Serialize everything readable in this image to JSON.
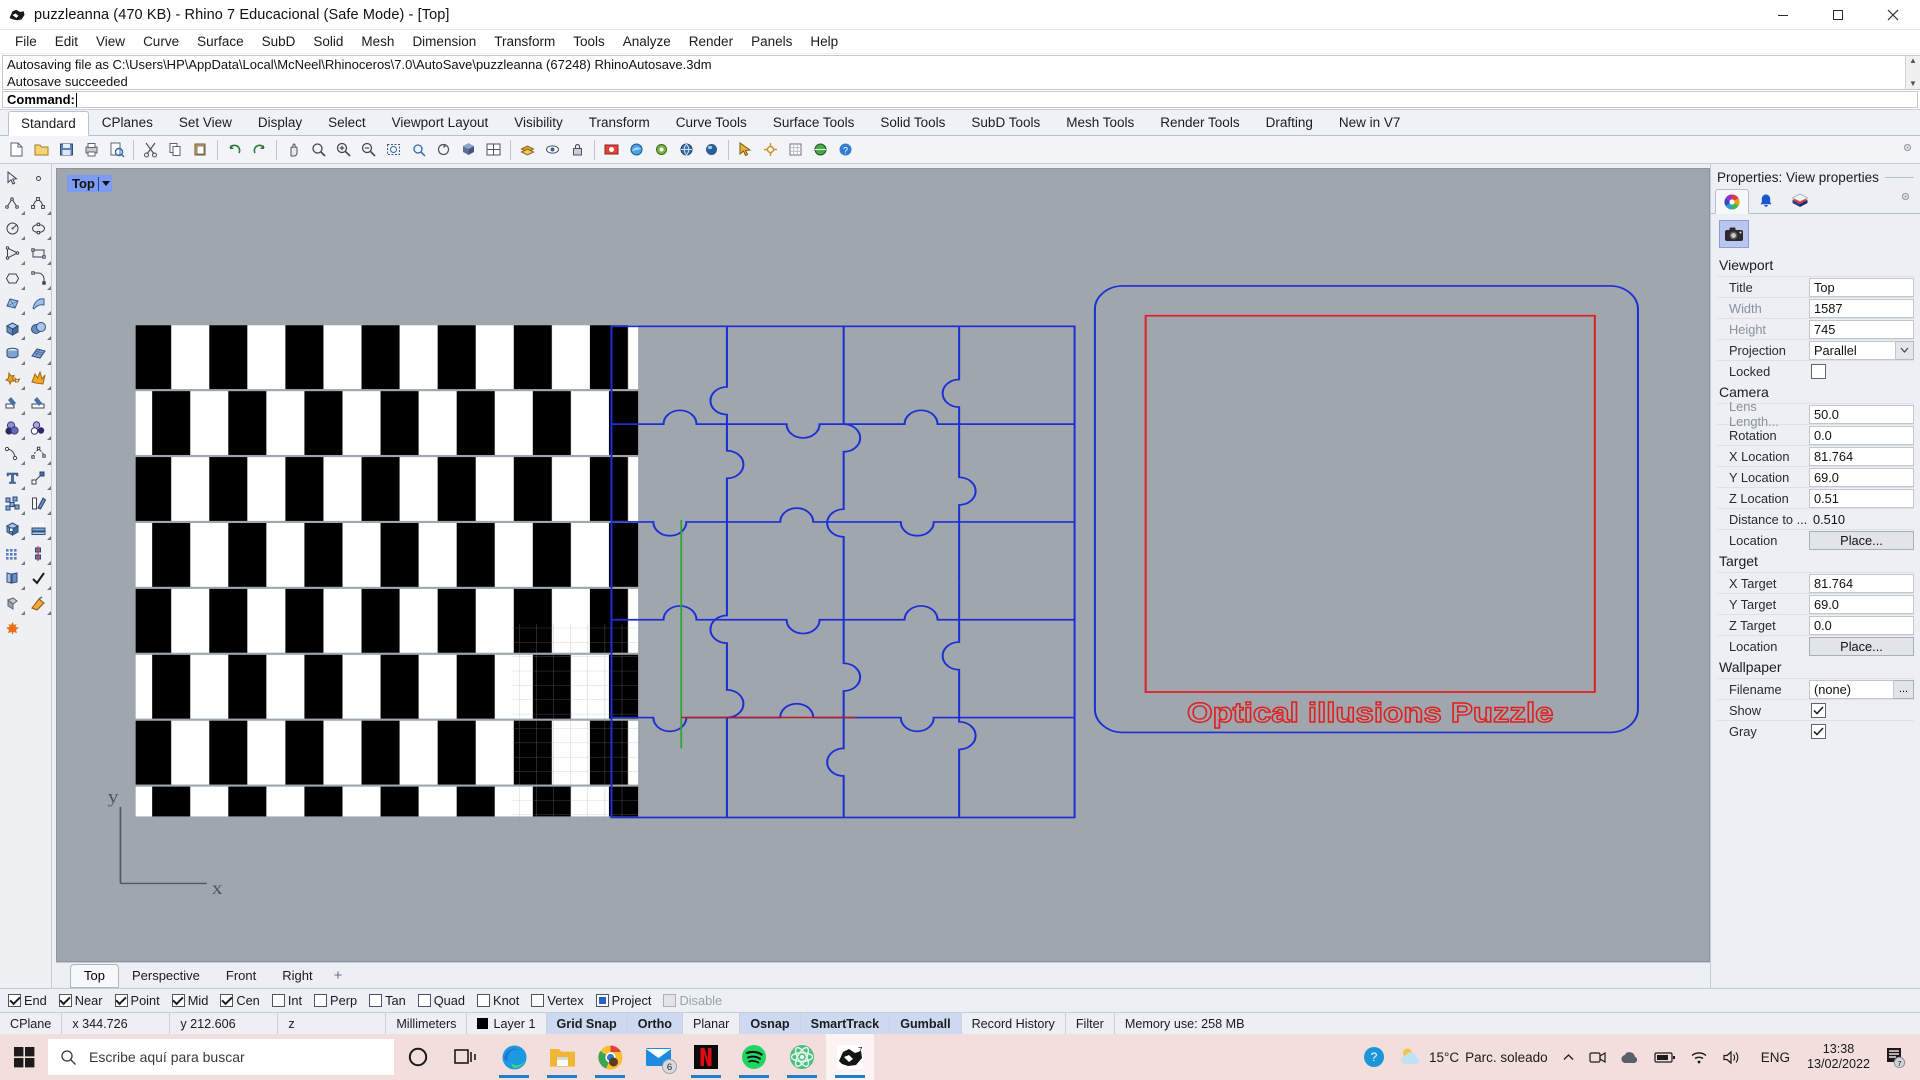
{
  "window": {
    "title": "puzzleanna (470 KB) - Rhino 7 Educacional (Safe Mode) - [Top]",
    "minimize_label": "Minimize",
    "maximize_label": "Restore",
    "close_label": "Close"
  },
  "menu": {
    "items": [
      {
        "label": "File"
      },
      {
        "label": "Edit"
      },
      {
        "label": "View"
      },
      {
        "label": "Curve"
      },
      {
        "label": "Surface"
      },
      {
        "label": "SubD"
      },
      {
        "label": "Solid"
      },
      {
        "label": "Mesh"
      },
      {
        "label": "Dimension"
      },
      {
        "label": "Transform"
      },
      {
        "label": "Tools"
      },
      {
        "label": "Analyze"
      },
      {
        "label": "Render"
      },
      {
        "label": "Panels"
      },
      {
        "label": "Help"
      }
    ]
  },
  "command": {
    "history": [
      "Autosaving file as C:\\Users\\HP\\AppData\\Local\\McNeel\\Rhinoceros\\7.0\\AutoSave\\puzzleanna (67248) RhinoAutosave.3dm",
      "Autosave succeeded"
    ],
    "prompt_label": "Command:",
    "prompt_value": ""
  },
  "toolbar_tabs": {
    "active": "Standard",
    "items": [
      {
        "label": "Standard"
      },
      {
        "label": "CPlanes"
      },
      {
        "label": "Set View"
      },
      {
        "label": "Display"
      },
      {
        "label": "Select"
      },
      {
        "label": "Viewport Layout"
      },
      {
        "label": "Visibility"
      },
      {
        "label": "Transform"
      },
      {
        "label": "Curve Tools"
      },
      {
        "label": "Surface Tools"
      },
      {
        "label": "Solid Tools"
      },
      {
        "label": "SubD Tools"
      },
      {
        "label": "Mesh Tools"
      },
      {
        "label": "Render Tools"
      },
      {
        "label": "Drafting"
      },
      {
        "label": "New in V7"
      }
    ]
  },
  "viewport": {
    "label": "Top",
    "annotation_text": "Optical illusions Puzzle",
    "annotation_color": "#e01f1f",
    "background_color": "#a0a6ad",
    "curve_color": "#1c2fd6",
    "axis_x_label": "x",
    "axis_y_label": "y",
    "tabs": [
      {
        "label": "Top",
        "active": true
      },
      {
        "label": "Perspective",
        "active": false
      },
      {
        "label": "Front",
        "active": false
      },
      {
        "label": "Right",
        "active": false
      }
    ],
    "add_tab_label": "+"
  },
  "properties": {
    "header": "Properties: View properties",
    "tabs": [
      {
        "name": "material-tab",
        "label": "Material"
      },
      {
        "name": "light-tab",
        "label": "Light"
      },
      {
        "name": "layer-tab",
        "label": "Layers"
      }
    ],
    "object_button_label": "View properties",
    "sections": [
      {
        "title": "Viewport",
        "rows": [
          {
            "key": "Title",
            "value": "Top",
            "type": "text",
            "dim": false
          },
          {
            "key": "Width",
            "value": "1587",
            "type": "text",
            "dim": true
          },
          {
            "key": "Height",
            "value": "745",
            "type": "text",
            "dim": true
          },
          {
            "key": "Projection",
            "value": "Parallel",
            "type": "dropdown",
            "dim": false
          },
          {
            "key": "Locked",
            "value": "",
            "type": "checkbox",
            "checked": false,
            "dim": false
          }
        ]
      },
      {
        "title": "Camera",
        "rows": [
          {
            "key": "Lens Length...",
            "value": "50.0",
            "type": "text",
            "dim": true
          },
          {
            "key": "Rotation",
            "value": "0.0",
            "type": "text",
            "dim": false
          },
          {
            "key": "X Location",
            "value": "81.764",
            "type": "text",
            "dim": false
          },
          {
            "key": "Y Location",
            "value": "69.0",
            "type": "text",
            "dim": false
          },
          {
            "key": "Z Location",
            "value": "0.51",
            "type": "text",
            "dim": false
          },
          {
            "key": "Distance to ...",
            "value": "0.510",
            "type": "readonly",
            "dim": false
          },
          {
            "key": "Location",
            "value": "Place...",
            "type": "button",
            "dim": false
          }
        ]
      },
      {
        "title": "Target",
        "rows": [
          {
            "key": "X Target",
            "value": "81.764",
            "type": "text",
            "dim": false
          },
          {
            "key": "Y Target",
            "value": "69.0",
            "type": "text",
            "dim": false
          },
          {
            "key": "Z Target",
            "value": "0.0",
            "type": "text",
            "dim": false
          },
          {
            "key": "Location",
            "value": "Place...",
            "type": "button",
            "dim": false
          }
        ]
      },
      {
        "title": "Wallpaper",
        "rows": [
          {
            "key": "Filename",
            "value": "(none)",
            "type": "file",
            "dim": false
          },
          {
            "key": "Show",
            "value": "",
            "type": "checkbox",
            "checked": true,
            "dim": false
          },
          {
            "key": "Gray",
            "value": "",
            "type": "checkbox",
            "checked": true,
            "dim": false
          }
        ]
      }
    ]
  },
  "osnap": {
    "items": [
      {
        "label": "End",
        "state": "checked"
      },
      {
        "label": "Near",
        "state": "checked"
      },
      {
        "label": "Point",
        "state": "checked"
      },
      {
        "label": "Mid",
        "state": "checked"
      },
      {
        "label": "Cen",
        "state": "checked"
      },
      {
        "label": "Int",
        "state": "unchecked"
      },
      {
        "label": "Perp",
        "state": "unchecked"
      },
      {
        "label": "Tan",
        "state": "unchecked"
      },
      {
        "label": "Quad",
        "state": "unchecked"
      },
      {
        "label": "Knot",
        "state": "unchecked"
      },
      {
        "label": "Vertex",
        "state": "unchecked"
      },
      {
        "label": "Project",
        "state": "filled"
      },
      {
        "label": "Disable",
        "state": "disabled"
      }
    ]
  },
  "statusbar": {
    "cplane_label": "CPlane",
    "x_value": "x 344.726",
    "y_value": "y 212.606",
    "z_value": "z",
    "units": "Millimeters",
    "layer": "Layer 1",
    "layer_color": "#000000",
    "toggles": [
      {
        "label": "Grid Snap",
        "on": true
      },
      {
        "label": "Ortho",
        "on": true
      },
      {
        "label": "Planar",
        "on": false
      },
      {
        "label": "Osnap",
        "on": true
      },
      {
        "label": "SmartTrack",
        "on": true
      },
      {
        "label": "Gumball",
        "on": true
      },
      {
        "label": "Record History",
        "on": false
      },
      {
        "label": "Filter",
        "on": false
      }
    ],
    "memory": "Memory use: 258 MB"
  },
  "taskbar": {
    "search_placeholder": "Escribe aquí para buscar",
    "apps": [
      {
        "name": "cortana-icon",
        "label": "Cortana"
      },
      {
        "name": "task-view-icon",
        "label": "Task View"
      },
      {
        "name": "edge-icon",
        "label": "Microsoft Edge"
      },
      {
        "name": "file-explorer-icon",
        "label": "File Explorer"
      },
      {
        "name": "chrome-icon",
        "label": "Google Chrome"
      },
      {
        "name": "mail-icon",
        "label": "Mail",
        "badge": "6"
      },
      {
        "name": "netflix-icon",
        "label": "Netflix"
      },
      {
        "name": "spotify-icon",
        "label": "Spotify"
      },
      {
        "name": "react-icon",
        "label": "App"
      },
      {
        "name": "rhino-icon",
        "label": "Rhinoceros 7"
      }
    ],
    "weather_temp": "15°C",
    "weather_desc": "Parc. soleado",
    "language": "ENG",
    "time": "13:38",
    "date": "13/02/2022",
    "notification_count": "7"
  }
}
